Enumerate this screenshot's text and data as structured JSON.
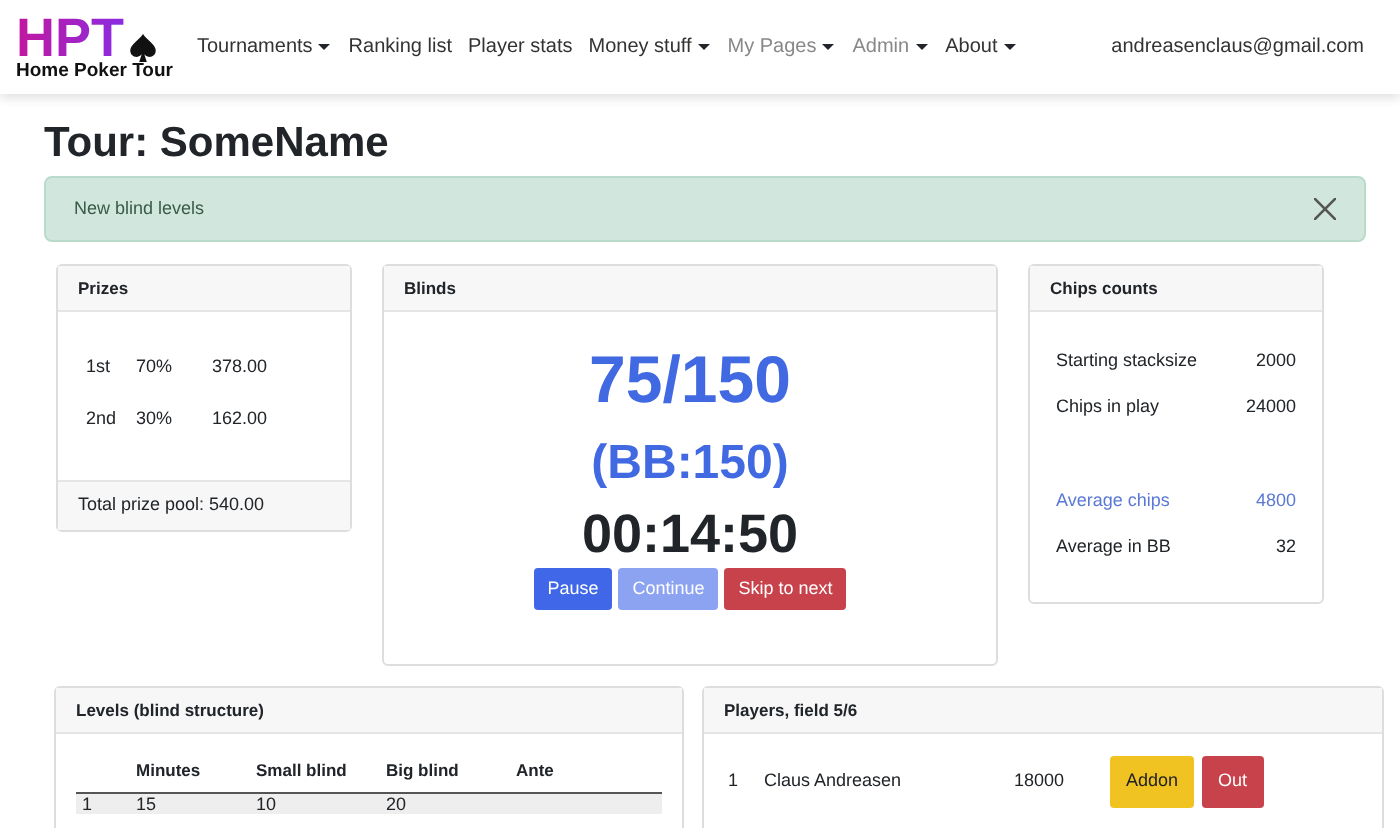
{
  "brand": {
    "logo": "HPT",
    "subtitle": "Home Poker Tour"
  },
  "nav": [
    {
      "label": "Tournaments",
      "dropdown": true,
      "disabled": false
    },
    {
      "label": "Ranking list",
      "dropdown": false,
      "disabled": false
    },
    {
      "label": "Player stats",
      "dropdown": false,
      "disabled": false
    },
    {
      "label": "Money stuff",
      "dropdown": true,
      "disabled": false
    },
    {
      "label": "My Pages",
      "dropdown": true,
      "disabled": true
    },
    {
      "label": "Admin",
      "dropdown": true,
      "disabled": true
    },
    {
      "label": "About",
      "dropdown": true,
      "disabled": false
    }
  ],
  "user": "andreasenclaus@gmail.com",
  "title": "Tour: SomeName",
  "alert": {
    "text": "New blind levels"
  },
  "prizes": {
    "title": "Prizes",
    "rows": [
      [
        "1st",
        "70%",
        "378.00"
      ],
      [
        "2nd",
        "30%",
        "162.00"
      ]
    ],
    "footer": "Total prize pool: 540.00"
  },
  "blinds": {
    "title": "Blinds",
    "level": "75/150",
    "big_blind": "(BB:150)",
    "clock": "00:14:50",
    "buttons": [
      {
        "label": "Pause",
        "kind": "primary",
        "disabled": false
      },
      {
        "label": "Continue",
        "kind": "primary",
        "disabled": true
      },
      {
        "label": "Skip to next",
        "kind": "danger",
        "disabled": false
      }
    ]
  },
  "chips": {
    "title": "Chips counts",
    "rows": [
      {
        "label": "Starting stacksize",
        "value": "2000",
        "highlight": false
      },
      {
        "label": "Chips in play",
        "value": "24000",
        "highlight": false
      },
      {
        "label": "Average chips",
        "value": "4800",
        "highlight": true
      },
      {
        "label": "Average in BB",
        "value": "32",
        "highlight": false
      }
    ]
  },
  "levels": {
    "title": "Levels (blind structure)",
    "columns": [
      "",
      "Minutes",
      "Small blind",
      "Big blind",
      "Ante"
    ],
    "rows": [
      [
        "1",
        "15",
        "10",
        "20",
        ""
      ]
    ]
  },
  "players": {
    "title": "Players, field 5/6",
    "rows": [
      {
        "rank": "1",
        "name": "Claus Andreasen",
        "chips": "18000",
        "buttons": [
          {
            "label": "Addon",
            "kind": "warning"
          },
          {
            "label": "Out",
            "kind": "danger"
          }
        ]
      }
    ]
  }
}
